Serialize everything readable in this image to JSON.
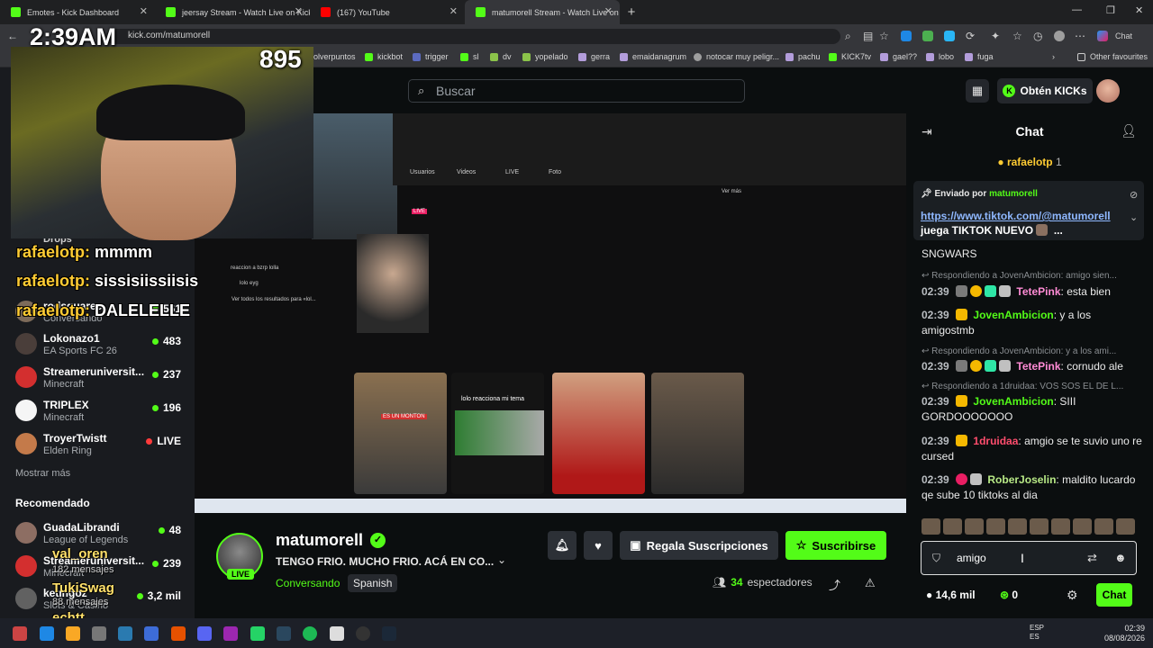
{
  "browser": {
    "tabs": [
      {
        "title": "Emotes - Kick Dashboard",
        "color": "#53fc18"
      },
      {
        "title": "jeersay Stream - Watch Live on Kick",
        "color": "#53fc18"
      },
      {
        "title": "(167) YouTube",
        "color": "#ff0000"
      },
      {
        "title": "matumorell Stream - Watch Live on Kick",
        "color": "#53fc18"
      }
    ],
    "url": "kick.com/matumorell",
    "bookmarks": [
      "olverpuntos",
      "kickbot",
      "trigger",
      "sl",
      "dv",
      "yopelado",
      "gerra",
      "emaidanagrum",
      "notocar muy peligr...",
      "pachu",
      "KICK7tv",
      "gael??",
      "lobo",
      "fuga"
    ],
    "other_favourites": "Other favourites",
    "profile_chat": "Chat"
  },
  "header": {
    "search_placeholder": "Buscar",
    "get_kicks": "Obtén KICKs"
  },
  "sidebar": {
    "drops": "Drops",
    "following": [
      {
        "name": "rodsquaree",
        "game": "Conversando",
        "count": "561"
      },
      {
        "name": "Lokonazo1",
        "game": "EA Sports FC 26",
        "count": "483"
      },
      {
        "name": "Streameruniversit...",
        "game": "Minecraft",
        "count": "237"
      },
      {
        "name": "TRIPLEX",
        "game": "Minecraft",
        "count": "196"
      },
      {
        "name": "TroyerTwistt",
        "game": "Elden Ring",
        "count": "LIVE"
      }
    ],
    "show_more": "Mostrar más",
    "recommended_heading": "Recomendado",
    "recommended": [
      {
        "name": "GuadaLibrandi",
        "game": "League of Legends",
        "count": "48"
      },
      {
        "name": "Streameruniversit...",
        "game": "Minecraft",
        "count": "239"
      },
      {
        "name": "ketingoz",
        "game": "Slots & Casino",
        "count": "3,2 mil"
      }
    ]
  },
  "overlay": {
    "clock": "2:39AM",
    "viewer_count": "895",
    "chat_lines": [
      {
        "user": "rafaelotp:",
        "text": "mmmm"
      },
      {
        "user": "rafaelotp:",
        "text": "sissisiissiisis"
      },
      {
        "user": "rafaelotp:",
        "text": "DALELELLE"
      }
    ],
    "lower_names": [
      "val_oren",
      "TukiSwag",
      "echtt"
    ],
    "lower_meta": [
      "182 mensajes",
      "88 mensajes"
    ],
    "video_texts": [
      "reaccion a bzrp lolla",
      "lolo eyg",
      "Ver todos los resultados para «lol...",
      "Usuarios",
      "Videos",
      "LIVE",
      "Foto",
      "Ver más",
      "lolo reacciona mi tema",
      "ES UN MONTON"
    ]
  },
  "stream": {
    "name": "matumorell",
    "title": "TENGO FRIO. MUCHO FRIO. ACÁ EN CO...",
    "category": "Conversando",
    "language": "Spanish",
    "live_badge": "LIVE",
    "gift_subs": "Regala Suscripciones",
    "subscribe": "Suscribirse",
    "viewers": "34",
    "viewers_label": "espectadores"
  },
  "chat": {
    "title": "Chat",
    "top_gifter": {
      "name": "rafaelotp",
      "count": "1"
    },
    "pinned": {
      "label": "Enviado por",
      "user": "matumorell",
      "link": "https://www.tiktok.com/@matumorell",
      "text": "juega TIKTOK NUEVO",
      "ellipsis": "..."
    },
    "messages": [
      {
        "kind": "text",
        "text": "SNGWARS"
      },
      {
        "kind": "reply",
        "text": "Respondiendo a JovenAmbicion: amigo sien..."
      },
      {
        "time": "02:39",
        "user": "TetePink",
        "color": "#ff8bd5",
        "text": "esta bien"
      },
      {
        "time": "02:39",
        "user": "JovenAmbicion",
        "color": "#53fc18",
        "text": "y a los amigostmb"
      },
      {
        "kind": "reply",
        "text": "Respondiendo a JovenAmbicion: y a los ami..."
      },
      {
        "time": "02:39",
        "user": "TetePink",
        "color": "#ff8bd5",
        "text": "cornudo ale"
      },
      {
        "kind": "reply",
        "text": "Respondiendo a 1druidaa: VOS SOS EL DE L..."
      },
      {
        "time": "02:39",
        "user": "JovenAmbicion",
        "color": "#53fc18",
        "text": "SIII GORDOOOOOOO"
      },
      {
        "time": "02:39",
        "user": "1druidaa",
        "color": "#ff4d6d",
        "text": "amgio se te suvio uno re cursed"
      },
      {
        "time": "02:39",
        "user": "RoberJoselin",
        "color": "#b8e986",
        "text": "maldito lucardo qe sube 10 tiktoks al dia"
      }
    ],
    "input_value": "amigo",
    "points": "14,6 mil",
    "kicks": "0",
    "send": "Chat"
  },
  "taskbar": {
    "lang": "ESP",
    "region": "ES",
    "time": "02:39",
    "date": "08/08/2026"
  },
  "colors": {
    "kick_green": "#53fc18",
    "background": "#0b0e0f",
    "sidebar": "#191b1f"
  }
}
